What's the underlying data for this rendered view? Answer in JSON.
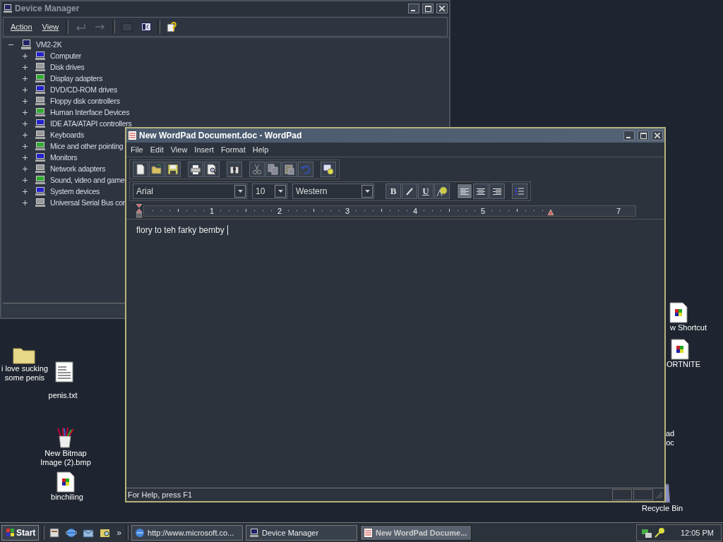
{
  "device_manager": {
    "title": "Device Manager",
    "menu": [
      "Action",
      "View"
    ],
    "tree": {
      "label": "VM2-2K",
      "expanded": true,
      "children": [
        {
          "label": "Computer",
          "expanded": false
        },
        {
          "label": "Disk drives",
          "expanded": false
        },
        {
          "label": "Display adapters",
          "expanded": false
        },
        {
          "label": "DVD/CD-ROM drives",
          "expanded": false
        },
        {
          "label": "Floppy disk controllers",
          "expanded": false
        },
        {
          "label": "Human Interface Devices",
          "expanded": false
        },
        {
          "label": "IDE ATA/ATAPI controllers",
          "expanded": false
        },
        {
          "label": "Keyboards",
          "expanded": false
        },
        {
          "label": "Mice and other pointing",
          "expanded": false
        },
        {
          "label": "Monitors",
          "expanded": false
        },
        {
          "label": "Network adapters",
          "expanded": false
        },
        {
          "label": "Sound, video and game",
          "expanded": false
        },
        {
          "label": "System devices",
          "expanded": false
        },
        {
          "label": "Universal Serial Bus cor",
          "expanded": false
        }
      ]
    }
  },
  "wordpad": {
    "title": "New WordPad Document.doc - WordPad",
    "menu": [
      "File",
      "Edit",
      "View",
      "Insert",
      "Format",
      "Help"
    ],
    "font": "Arial",
    "size": "10",
    "script": "Western",
    "bold_label": "B",
    "underline_label": "U",
    "alignment": [
      {
        "selected": true
      },
      {
        "selected": false
      },
      {
        "selected": false
      }
    ],
    "ruler_numbers": [
      "1",
      "2",
      "3",
      "4",
      "5",
      "7"
    ],
    "text": "flory to teh farky bemby",
    "status": "For Help, press F1"
  },
  "desktop_icons": [
    {
      "label": "i love sucking some penis",
      "kind": "folder"
    },
    {
      "label": "penis.txt",
      "kind": "text"
    },
    {
      "label": "New Bitmap Image (2).bmp",
      "kind": "bitmap"
    },
    {
      "label": "binchiling",
      "kind": "document"
    },
    {
      "label": "w Shortcut",
      "kind": "document"
    },
    {
      "label": "ORTNITE",
      "kind": "document"
    },
    {
      "label": "ad oc",
      "kind": "hidden"
    },
    {
      "label": "Recycle Bin",
      "kind": "bin"
    }
  ],
  "taskbar": {
    "start": "Start",
    "chevron": "»",
    "tasks": [
      {
        "label": "http://www.microsoft.co...",
        "kind": "browser",
        "selected": false
      },
      {
        "label": "Device Manager",
        "kind": "computer",
        "selected": false
      },
      {
        "label": "New WordPad Docume...",
        "kind": "wordpad",
        "selected": true
      }
    ],
    "clock": "12:05 PM"
  }
}
